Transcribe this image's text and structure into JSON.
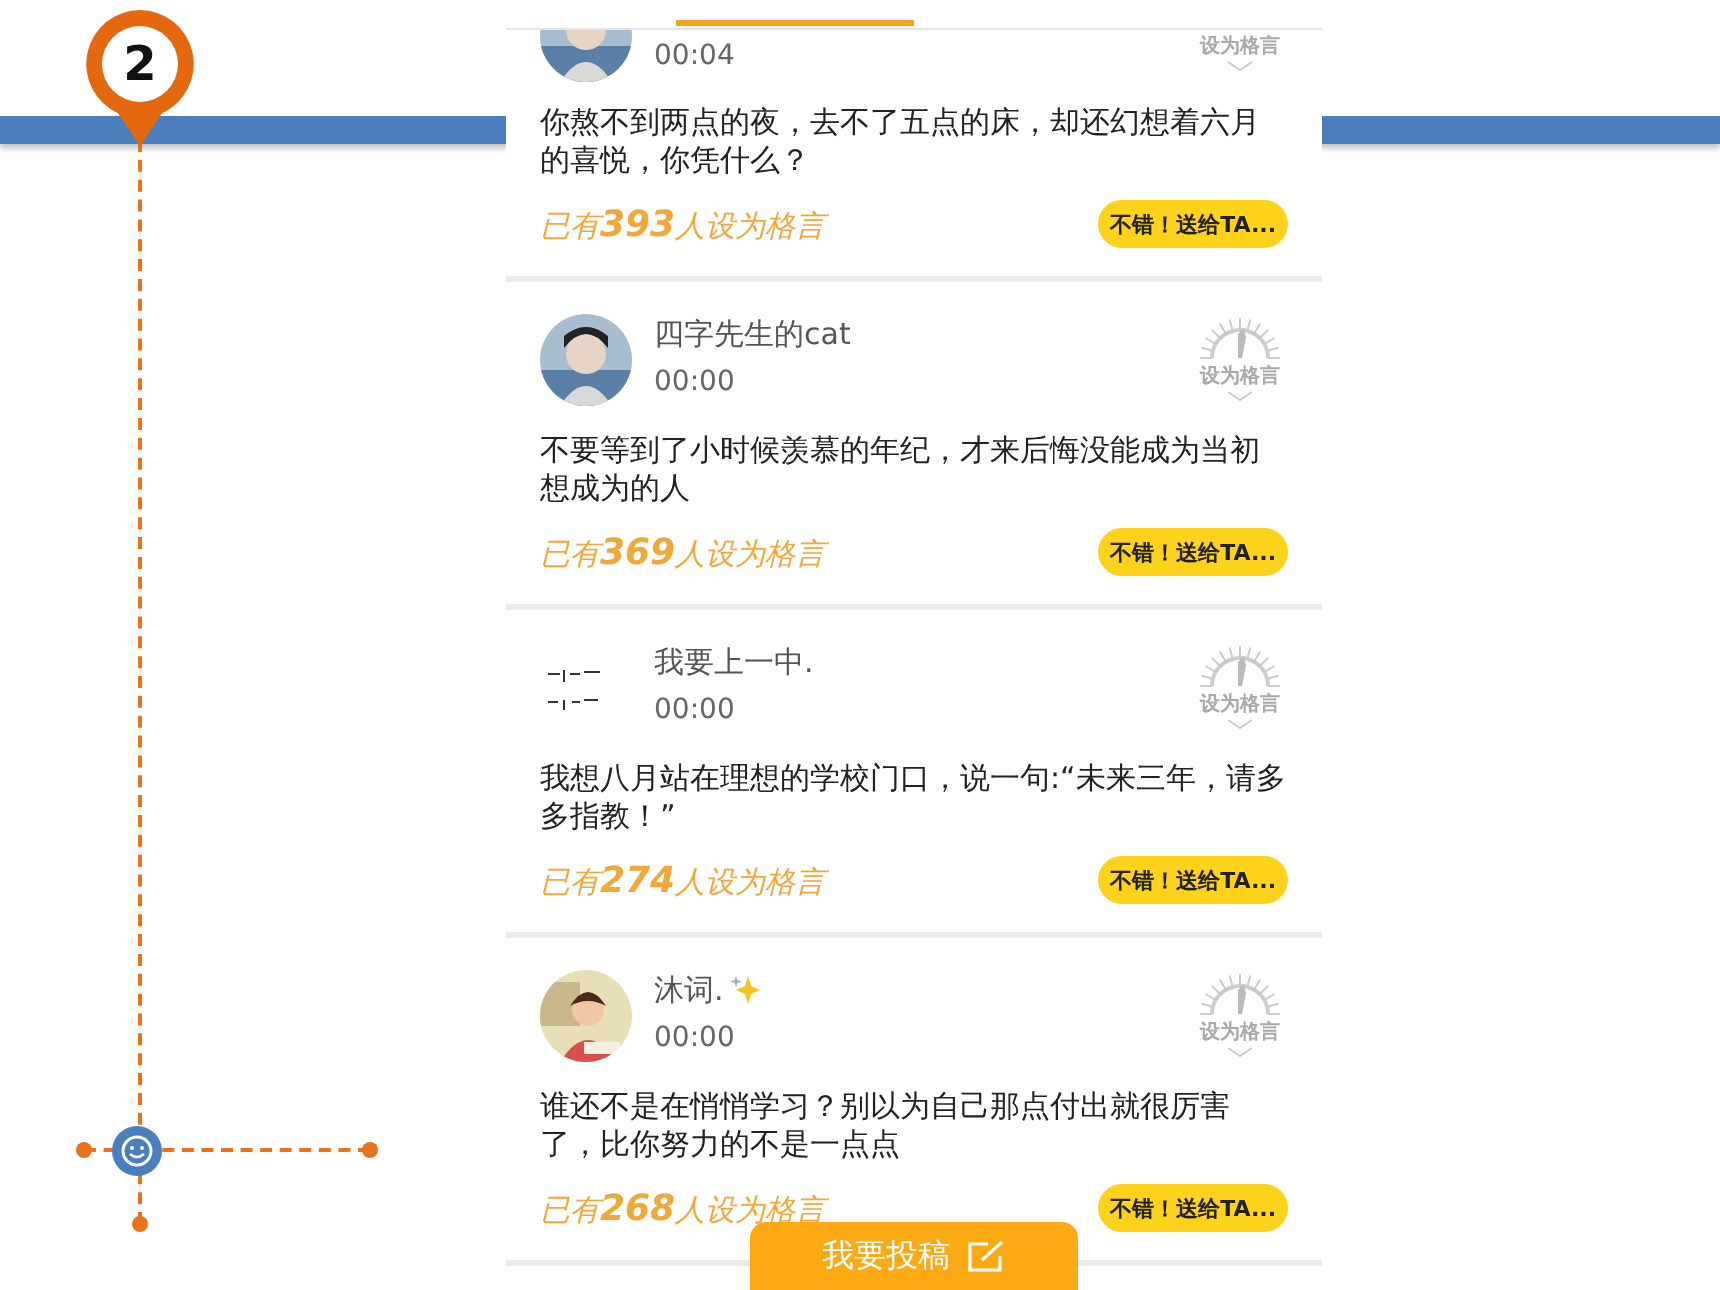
{
  "slide": {
    "step": "2"
  },
  "app": {
    "posts": [
      {
        "cut_off": true,
        "time": "00:04",
        "text": "你熬不到两点的夜，去不了五点的床，却还幻想着六月的喜悦，你凭什么？",
        "count": "已有**393**人设为格言",
        "stamp": "设为格言",
        "send": "不错！送给TA..."
      },
      {
        "cut_off": false,
        "name": "四字先生的cat",
        "sparkle": false,
        "time": "00:00",
        "text": "不要等到了小时候羡慕的年纪，才来后悔没能成为当初想成为的人",
        "count": "已有**369**人设为格言",
        "stamp": "设为格言",
        "send": "不错！送给TA..."
      },
      {
        "cut_off": false,
        "name": "我要上一中.",
        "sparkle": false,
        "time": "00:00",
        "text": "我想八月站在理想的学校门口，说一句:“未来三年，请多多指教！”",
        "count": "已有**274**人设为格言",
        "stamp": "设为格言",
        "send": "不错！送给TA..."
      },
      {
        "cut_off": false,
        "name": "沐词.",
        "sparkle": true,
        "time": "00:00",
        "text": "谁还不是在悄悄学习？别以为自己那点付出就很厉害了，比你努力的不是一点点",
        "count": "已有**268**人设为格言",
        "stamp": "设为格言",
        "send": "不错！送给TA..."
      }
    ],
    "submit_button": "我要投稿"
  }
}
